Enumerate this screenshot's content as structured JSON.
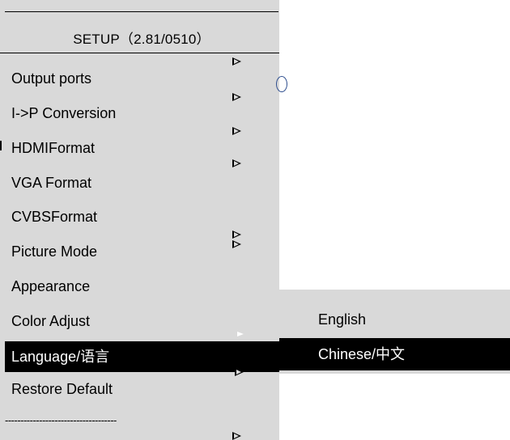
{
  "menu": {
    "title": "SETUP（2.81/0510）",
    "items": [
      {
        "label": "Output ports"
      },
      {
        "label": "I->P Conversion"
      },
      {
        "label": "HDMIFormat"
      },
      {
        "label": "VGA Format"
      },
      {
        "label": "CVBSFormat"
      },
      {
        "label": "Picture Mode"
      },
      {
        "label": "Appearance"
      },
      {
        "label": "Color Adjust"
      },
      {
        "label": "Language/语言",
        "selected": true
      },
      {
        "label": "Restore Default"
      }
    ],
    "divider": "------------------------------------"
  },
  "submenu": {
    "items": [
      {
        "label": "English"
      },
      {
        "label": "Chinese/中文",
        "selected": true
      }
    ]
  },
  "icons": {
    "submenu_arrow": "triangle-right-icon",
    "cursor": "ring-cursor-icon"
  },
  "colors": {
    "panel_background": "#d9d9d9",
    "selected_background": "#000000",
    "selected_text": "#ffffff"
  }
}
